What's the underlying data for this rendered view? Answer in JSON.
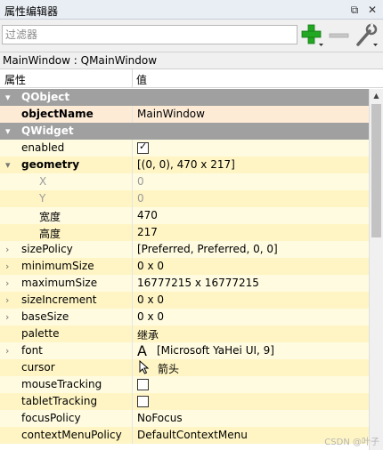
{
  "panel": {
    "title": "属性编辑器",
    "float_icon": "⧉",
    "close_icon": "✕"
  },
  "filter": {
    "placeholder": "过滤器",
    "value": ""
  },
  "object_info": "MainWindow : QMainWindow",
  "header": {
    "property_col": "属性",
    "value_col": "值"
  },
  "rows": [
    {
      "name": "QObject",
      "value": "",
      "style": "cat",
      "arrow": "▾"
    },
    {
      "name": "objectName",
      "value": "MainWindow",
      "style": "peach",
      "bold": true
    },
    {
      "name": "QWidget",
      "value": "",
      "style": "cat",
      "arrow": "▾"
    },
    {
      "name": "enabled",
      "value": "",
      "style": "y1",
      "checkbox": true,
      "checked": true
    },
    {
      "name": "geometry",
      "value": "[(0, 0), 470 x 217]",
      "style": "y2",
      "bold": true,
      "arrow": "▾"
    },
    {
      "name": "X",
      "value": "0",
      "style": "y1",
      "dim": true,
      "indent": 2
    },
    {
      "name": "Y",
      "value": "0",
      "style": "y2",
      "dim": true,
      "indent": 2
    },
    {
      "name": "宽度",
      "value": "470",
      "style": "y1",
      "indent": 2
    },
    {
      "name": "高度",
      "value": "217",
      "style": "y2",
      "indent": 2
    },
    {
      "name": "sizePolicy",
      "value": "[Preferred, Preferred, 0, 0]",
      "style": "y1",
      "arrow": "›"
    },
    {
      "name": "minimumSize",
      "value": "0 x 0",
      "style": "y2",
      "arrow": "›"
    },
    {
      "name": "maximumSize",
      "value": "16777215 x 16777215",
      "style": "y1",
      "arrow": "›"
    },
    {
      "name": "sizeIncrement",
      "value": "0 x 0",
      "style": "y2",
      "arrow": "›"
    },
    {
      "name": "baseSize",
      "value": "0 x 0",
      "style": "y1",
      "arrow": "›"
    },
    {
      "name": "palette",
      "value": "继承",
      "style": "y2"
    },
    {
      "name": "font",
      "value": "[Microsoft YaHei UI, 9]",
      "style": "y1",
      "arrow": "›",
      "icon": "A"
    },
    {
      "name": "cursor",
      "value": "箭头",
      "style": "y2",
      "cursor_icon": true
    },
    {
      "name": "mouseTracking",
      "value": "",
      "style": "y1",
      "checkbox": true,
      "checked": false
    },
    {
      "name": "tabletTracking",
      "value": "",
      "style": "y2",
      "checkbox": true,
      "checked": false
    },
    {
      "name": "focusPolicy",
      "value": "NoFocus",
      "style": "y1"
    },
    {
      "name": "contextMenuPolicy",
      "value": "DefaultContextMenu",
      "style": "y2"
    }
  ],
  "watermark": "CSDN @叶子",
  "colors": {
    "category_bg": "#a0a0a0",
    "object_name_bg": "#fdebd6",
    "row_yellow_light": "#fffbe0",
    "row_yellow": "#fff5c4",
    "add_button": "#22a722"
  },
  "icons": {
    "add": "plus-icon",
    "remove": "minus-icon",
    "configure": "wrench-icon"
  }
}
